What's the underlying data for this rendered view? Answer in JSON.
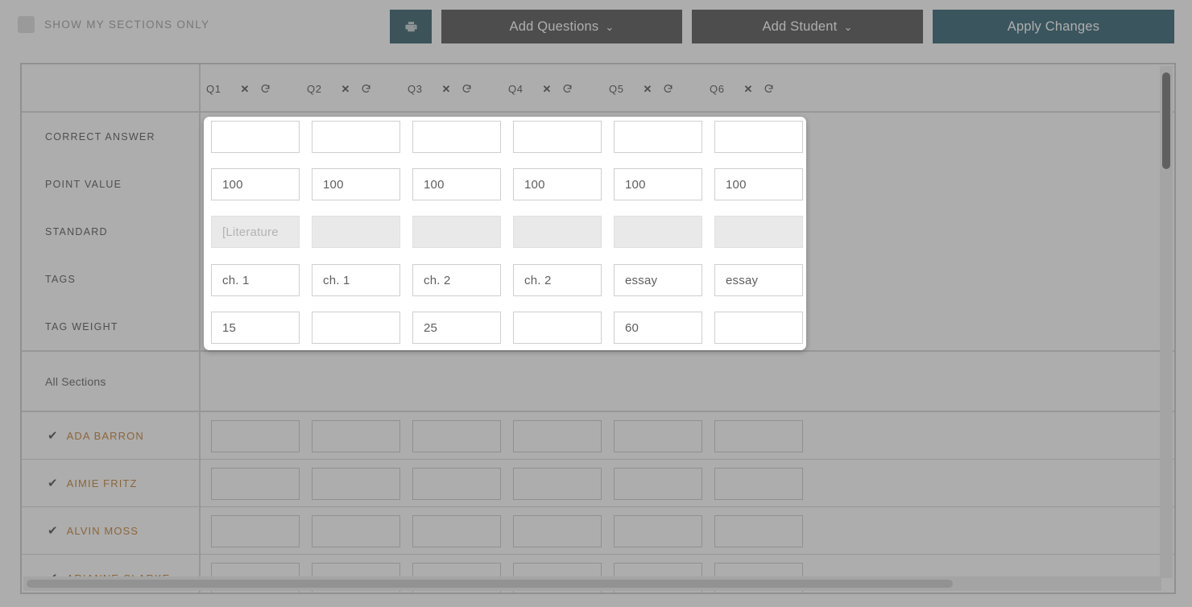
{
  "toolbar": {
    "show_my_sections_label": "SHOW MY SECTIONS ONLY",
    "show_my_sections_checked": false,
    "print_icon": "printer-icon",
    "add_questions_label": "Add Questions",
    "add_student_label": "Add Student",
    "apply_changes_label": "Apply Changes",
    "caret_glyph": "⌄",
    "accent_teal": "#27596b",
    "button_dark": "#4a4a4a",
    "print_teal": "#2b5563"
  },
  "grid": {
    "question_columns": [
      {
        "label": "Q1",
        "delete_icon": "close-icon",
        "reset_icon": "reset-icon"
      },
      {
        "label": "Q2",
        "delete_icon": "close-icon",
        "reset_icon": "reset-icon"
      },
      {
        "label": "Q3",
        "delete_icon": "close-icon",
        "reset_icon": "reset-icon"
      },
      {
        "label": "Q4",
        "delete_icon": "close-icon",
        "reset_icon": "reset-icon"
      },
      {
        "label": "Q5",
        "delete_icon": "close-icon",
        "reset_icon": "reset-icon"
      },
      {
        "label": "Q6",
        "delete_icon": "close-icon",
        "reset_icon": "reset-icon"
      }
    ],
    "attribute_rows": [
      {
        "label": "CORRECT ANSWER",
        "key": "correct_answer"
      },
      {
        "label": "POINT VALUE",
        "key": "point_value"
      },
      {
        "label": "STANDARD",
        "key": "standard"
      },
      {
        "label": "TAGS",
        "key": "tags"
      },
      {
        "label": "TAG WEIGHT",
        "key": "tag_weight"
      }
    ],
    "attribute_values": {
      "correct_answer": [
        "",
        "",
        "",
        "",
        "",
        ""
      ],
      "point_value": [
        "100",
        "100",
        "100",
        "100",
        "100",
        "100"
      ],
      "standard": [
        "",
        "",
        "",
        "",
        "",
        ""
      ],
      "standard_placeholder": [
        "[Literature",
        "",
        "",
        "",
        "",
        ""
      ],
      "tags": [
        "ch. 1",
        "ch. 1",
        "ch. 2",
        "ch. 2",
        "essay",
        "essay"
      ],
      "tag_weight": [
        "15",
        "",
        "25",
        "",
        "60",
        ""
      ]
    },
    "standard_readonly": true,
    "sections_label": "All Sections",
    "students": [
      {
        "name": "ADA BARRON",
        "checked": true,
        "scores": [
          "",
          "",
          "",
          "",
          "",
          ""
        ]
      },
      {
        "name": "AIMIE FRITZ",
        "checked": true,
        "scores": [
          "",
          "",
          "",
          "",
          "",
          ""
        ]
      },
      {
        "name": "ALVIN MOSS",
        "checked": true,
        "scores": [
          "",
          "",
          "",
          "",
          "",
          ""
        ]
      },
      {
        "name": "ARIANNE CLARKE",
        "checked": true,
        "scores": [
          "",
          "",
          "",
          "",
          "",
          ""
        ]
      }
    ],
    "student_name_color": "#c07a28",
    "check_glyph": "✔"
  },
  "scrollbars": {
    "vertical_thumb_name": "vertical-scrollbar-thumb",
    "horizontal_thumb_name": "horizontal-scrollbar-thumb"
  }
}
